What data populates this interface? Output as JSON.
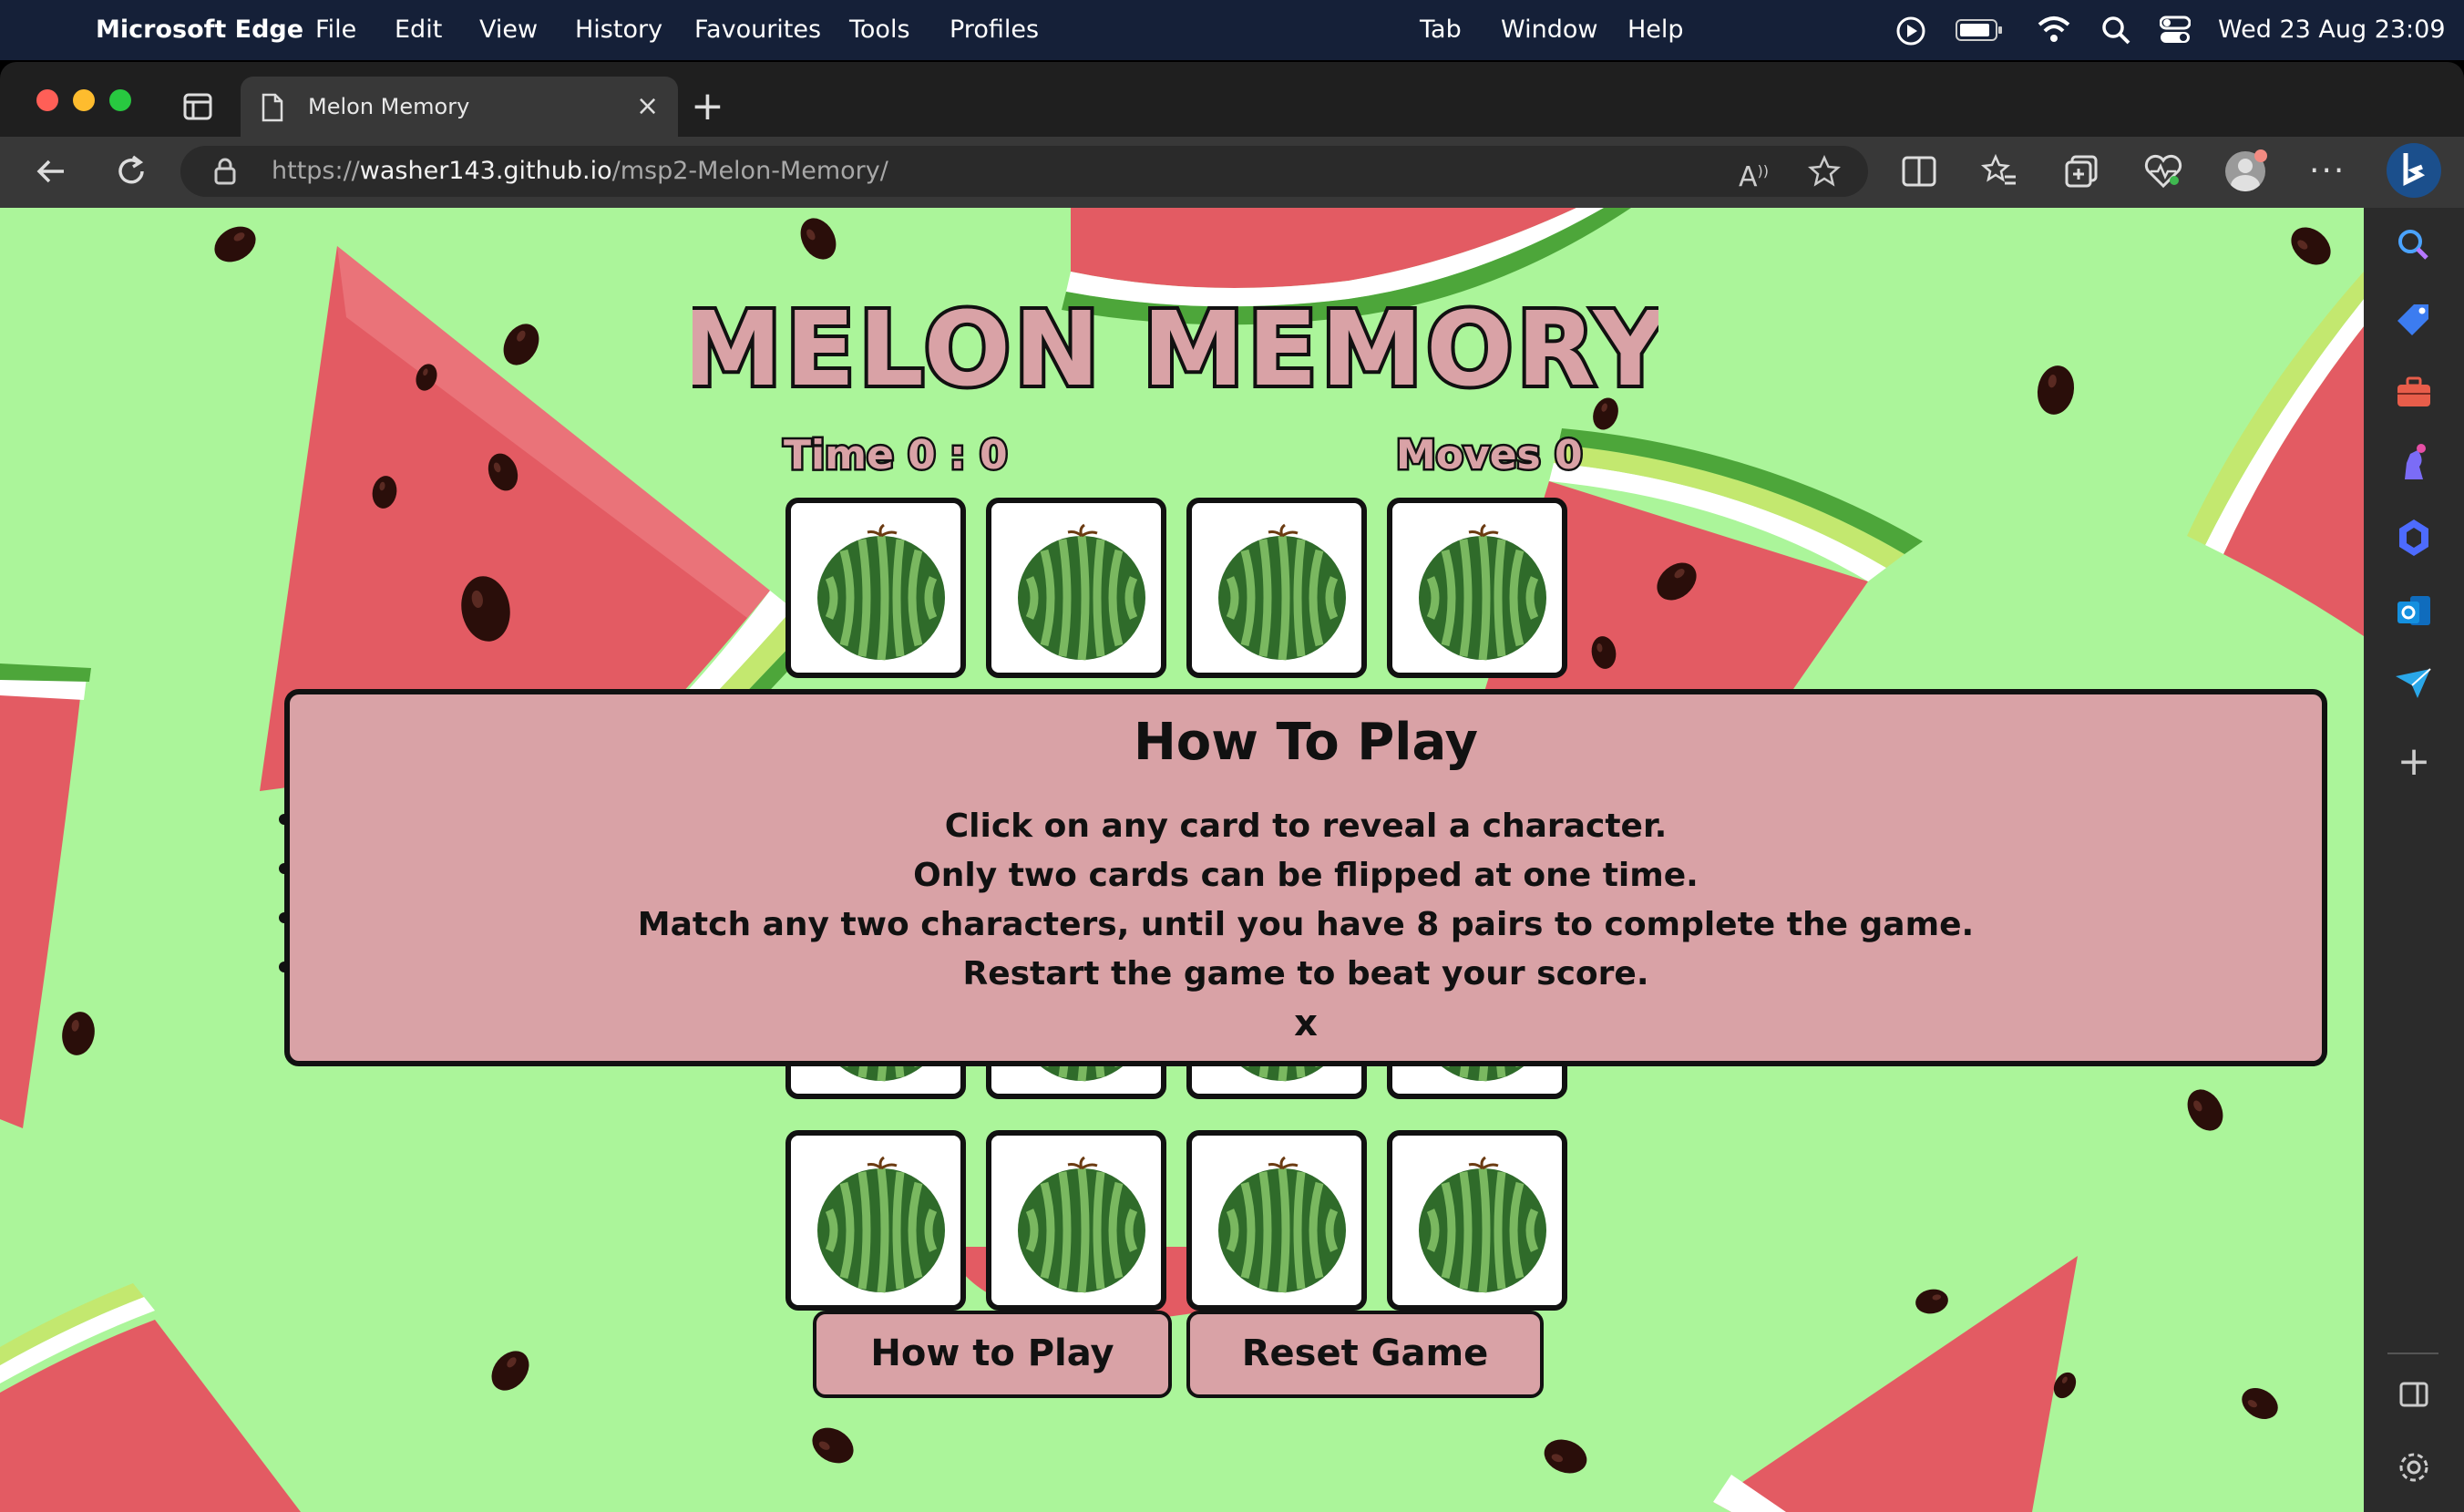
{
  "menubar": {
    "app": "Microsoft Edge",
    "items": [
      "File",
      "Edit",
      "View",
      "History",
      "Favourites",
      "Tools",
      "Profiles"
    ],
    "right_items": [
      "Tab",
      "Window",
      "Help"
    ],
    "clock": "Wed 23 Aug  23:09"
  },
  "browser": {
    "tab_title": "Melon Memory",
    "url_prefix": "https://",
    "url_host": "washer143.github.io",
    "url_path": "/msp2-Melon-Memory/"
  },
  "game": {
    "title": "MELON MEMORY",
    "time_label": "Time 0 : 0",
    "moves_label": "Moves 0"
  },
  "modal": {
    "heading": "How To Play",
    "lines": [
      "Click on any card to reveal a character.",
      "Only two cards can be flipped at one time.",
      "Match any two characters, until you have 8 pairs to complete the game.",
      "Restart the game to beat your score."
    ],
    "close": "x"
  },
  "buttons": {
    "how_to_play": "How to Play",
    "reset": "Reset Game"
  },
  "colors": {
    "page_bg": "#abf59a",
    "pink": "#d9a2a6",
    "melon_red": "#e35b63"
  }
}
